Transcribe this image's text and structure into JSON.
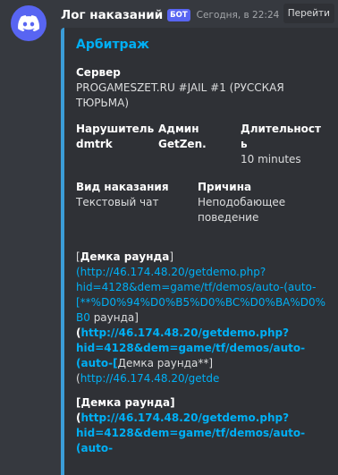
{
  "message": {
    "username": "Лог наказаний",
    "bot_tag": "БОТ",
    "timestamp": "Сегодня, в 22:24",
    "jump_label": "Перейти"
  },
  "embed": {
    "title": "Арбитраж",
    "accent_color": "#3b9dd8",
    "server": {
      "name": "Сервер",
      "value_line1": "PROGAMESZET.RU #JAIL #1 (РУССКАЯ",
      "value_line2": "ТЮРЬМА)"
    },
    "violator": {
      "name": "Нарушитель",
      "value": "dmtrk"
    },
    "admin": {
      "name": "Админ",
      "value": "GetZen."
    },
    "duration": {
      "name_line1": "Длительност",
      "name_line2": "ь",
      "value": "10 minutes"
    },
    "punishment": {
      "name": "Вид наказания",
      "value": "Текстовый чат"
    },
    "reason": {
      "name": "Причина",
      "value_line1": "Неподобающее",
      "value_line2": "поведение"
    },
    "description": {
      "p1_l1_open": "[",
      "p1_l1_label": "Демка раунда",
      "p1_l1_close": "]",
      "p1_l2": "(http://46.174.48.20/getdemo.php?",
      "p1_l3": "hid=4128&dem=game/tf/demos/auto-(auto-",
      "p1_l4": "[**%D0%94%D0%B5%D0%BC%D0%BA%D0%",
      "p1_l5_link": "B0",
      "p1_l5_text": " раунда]",
      "p1_l6_paren": "(",
      "p1_l6_link": "http://46.174.48.20/getdemo.php?",
      "p1_l7": "hid=4128&dem=game/tf/demos/auto-",
      "p1_l8_link": "(auto-[",
      "p1_l8_text": "Демка раунда**]",
      "p1_l9_paren": "(",
      "p1_l9_link": "http://46.174.48.20/getde",
      "p2_l1": "[Демка раунда]",
      "p2_l2_paren": "(",
      "p2_l2_link": "http://46.174.48.20/getdemo.php?",
      "p2_l3": "hid=4128&dem=game/tf/demos/auto-",
      "p2_l4": "(auto-"
    }
  }
}
